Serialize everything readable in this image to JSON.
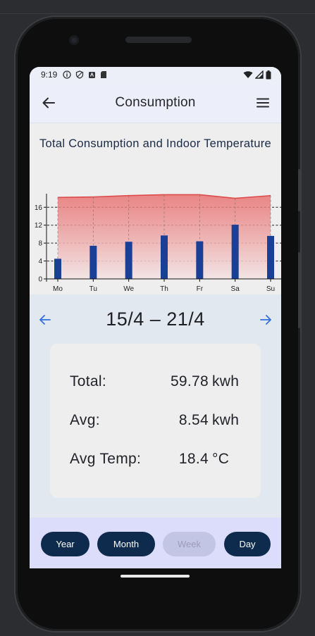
{
  "status_bar": {
    "time": "9:19"
  },
  "app_bar": {
    "title": "Consumption",
    "back_icon": "arrow-left-icon",
    "menu_icon": "hamburger-menu-icon"
  },
  "chart_data": {
    "type": "bar",
    "title": "Total Consumption and Indoor Temperature",
    "categories": [
      "Mo",
      "Tu",
      "We",
      "Th",
      "Fr",
      "Sa",
      "Su"
    ],
    "series": [
      {
        "values": [
          4.5,
          7.4,
          8.3,
          9.7,
          8.4,
          12.1,
          9.6
        ]
      },
      {
        "values": [
          18.2,
          18.3,
          18.6,
          18.8,
          18.8,
          18.0,
          18.6
        ]
      }
    ],
    "yticks": [
      0,
      4,
      8,
      12,
      16
    ],
    "ylim": [
      0,
      19.5
    ],
    "grid": true,
    "colors": {
      "bar": "#1a3f97",
      "temp_line": "#dd4b4b",
      "temp_fill_top": "#e86c6c",
      "temp_fill_bottom": "#f3e4e4"
    }
  },
  "week_nav": {
    "label": "15/4 – 21/4",
    "prev_icon": "arrow-left-icon",
    "next_icon": "arrow-right-icon",
    "accent": "#2f6fe0"
  },
  "summary": {
    "total": {
      "label": "Total:",
      "value": "59.78",
      "unit": "kwh"
    },
    "avg": {
      "label": "Avg:",
      "value": "8.54",
      "unit": "kwh"
    },
    "avg_temp": {
      "label": "Avg Temp:",
      "value": "18.4",
      "unit": "°C"
    }
  },
  "period_buttons": {
    "year": "Year",
    "month": "Month",
    "week": "Week",
    "day": "Day",
    "selected": "Week"
  }
}
